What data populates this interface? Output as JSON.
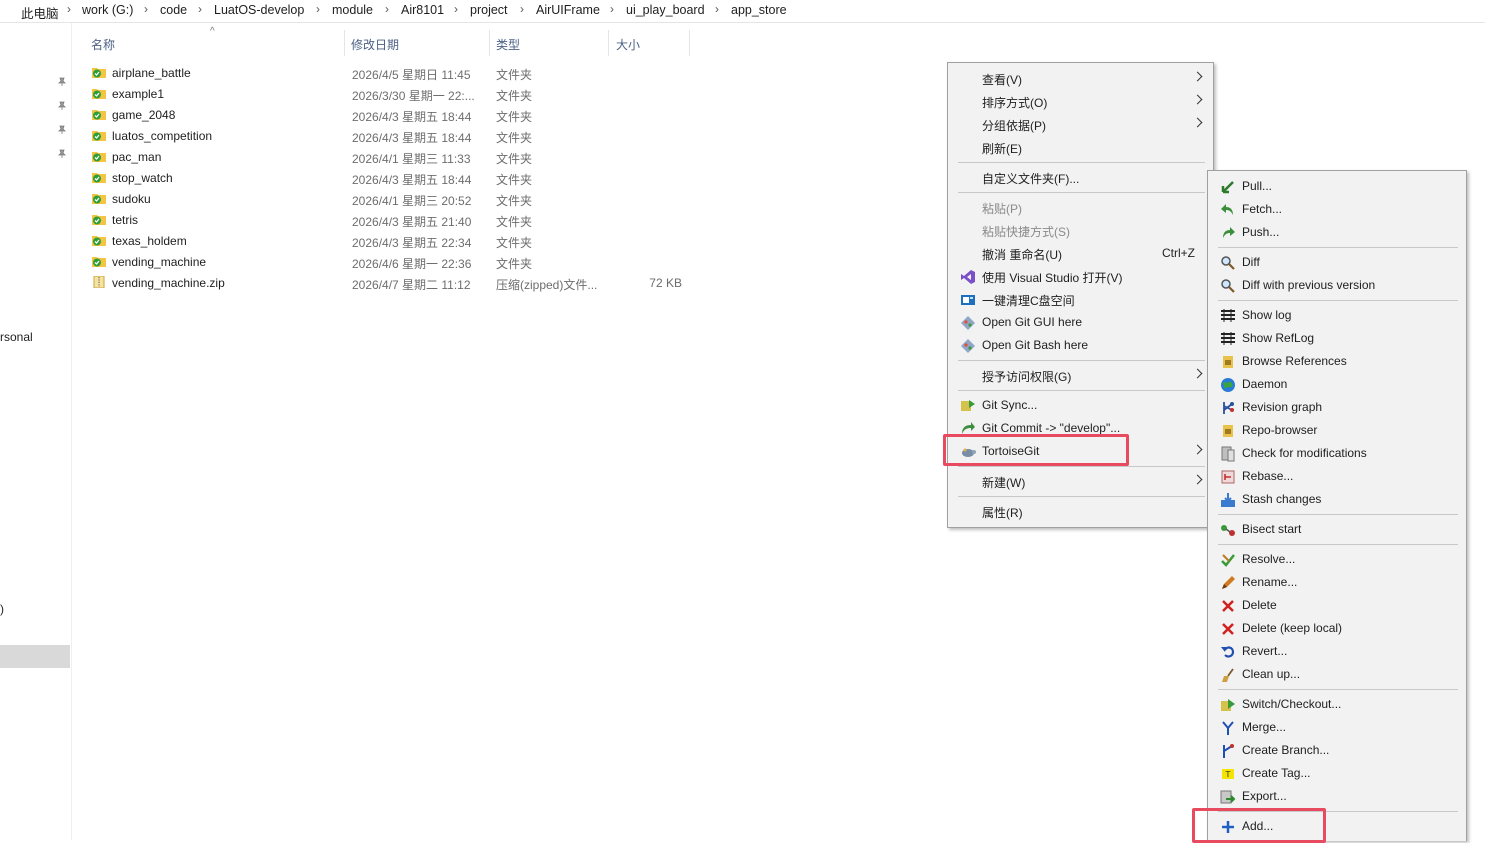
{
  "breadcrumb": [
    "此电脑",
    "work (G:)",
    "code",
    "LuatOS-develop",
    "module",
    "Air8101",
    "project",
    "AirUIFrame",
    "ui_play_board",
    "app_store"
  ],
  "nav": {
    "personal_text": "rsonal",
    "paren_text": ")"
  },
  "columns": {
    "name": "名称",
    "modified": "修改日期",
    "type": "类型",
    "size": "大小"
  },
  "files": [
    {
      "name": "airplane_battle",
      "date": "2026/4/5 星期日 11:45",
      "type": "文件夹",
      "size": ""
    },
    {
      "name": "example1",
      "date": "2026/3/30 星期一 22:...",
      "type": "文件夹",
      "size": ""
    },
    {
      "name": "game_2048",
      "date": "2026/4/3 星期五 18:44",
      "type": "文件夹",
      "size": ""
    },
    {
      "name": "luatos_competition",
      "date": "2026/4/3 星期五 18:44",
      "type": "文件夹",
      "size": ""
    },
    {
      "name": "pac_man",
      "date": "2026/4/1 星期三 11:33",
      "type": "文件夹",
      "size": ""
    },
    {
      "name": "stop_watch",
      "date": "2026/4/3 星期五 18:44",
      "type": "文件夹",
      "size": ""
    },
    {
      "name": "sudoku",
      "date": "2026/4/1 星期三 20:52",
      "type": "文件夹",
      "size": ""
    },
    {
      "name": "tetris",
      "date": "2026/4/3 星期五 21:40",
      "type": "文件夹",
      "size": ""
    },
    {
      "name": "texas_holdem",
      "date": "2026/4/3 星期五 22:34",
      "type": "文件夹",
      "size": ""
    },
    {
      "name": "vending_machine",
      "date": "2026/4/6 星期一 22:36",
      "type": "文件夹",
      "size": ""
    },
    {
      "name": "vending_machine.zip",
      "date": "2026/4/7 星期二 11:12",
      "type": "压缩(zipped)文件...",
      "size": "72 KB"
    }
  ],
  "context_menu": {
    "view": "查看(V)",
    "sort": "排序方式(O)",
    "group": "分组依据(P)",
    "refresh": "刷新(E)",
    "customize": "自定义文件夹(F)...",
    "paste": "粘贴(P)",
    "paste_shortcut": "粘贴快捷方式(S)",
    "undo_rename": "撤消 重命名(U)",
    "undo_shortcut": "Ctrl+Z",
    "open_vs": "使用 Visual Studio 打开(V)",
    "clean_c": "一键清理C盘空间",
    "git_gui": "Open Git GUI here",
    "git_bash": "Open Git Bash here",
    "grant_access": "授予访问权限(G)",
    "git_sync": "Git Sync...",
    "git_commit": "Git Commit -> \"develop\"...",
    "tortoisegit": "TortoiseGit",
    "new": "新建(W)",
    "properties": "属性(R)"
  },
  "tortoise_menu": {
    "pull": "Pull...",
    "fetch": "Fetch...",
    "push": "Push...",
    "diff": "Diff",
    "diff_prev": "Diff with previous version",
    "show_log": "Show log",
    "show_reflog": "Show RefLog",
    "browse_refs": "Browse References",
    "daemon": "Daemon",
    "revision_graph": "Revision graph",
    "repo_browser": "Repo-browser",
    "check_mods": "Check for modifications",
    "rebase": "Rebase...",
    "stash": "Stash changes",
    "bisect": "Bisect start",
    "resolve": "Resolve...",
    "rename": "Rename...",
    "delete": "Delete",
    "delete_keep": "Delete (keep local)",
    "revert": "Revert...",
    "cleanup": "Clean up...",
    "switch": "Switch/Checkout...",
    "merge": "Merge...",
    "create_branch": "Create Branch...",
    "create_tag": "Create Tag...",
    "export": "Export...",
    "add": "Add..."
  },
  "colors": {
    "highlight_box": "#e84a5f",
    "folder_yellow": "#f4c542",
    "git_check_green": "#2e9e3b",
    "menu_bg": "#f2f2f2"
  }
}
